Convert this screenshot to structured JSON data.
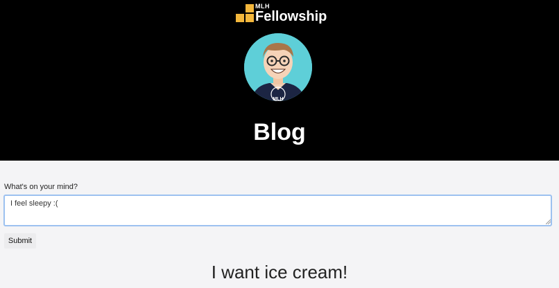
{
  "header": {
    "logo": {
      "small_text": "MLH",
      "big_text": "Fellowship",
      "color": "#f3b73c"
    },
    "avatar": {
      "icon": "avatar-illustration",
      "background": "#5ecfd8"
    },
    "title": "Blog",
    "background": "#000000"
  },
  "form": {
    "label": "What's on your mind?",
    "input_value": "I feel sleepy :(",
    "submit_label": "Submit"
  },
  "posts": [
    {
      "title": "I want ice cream!"
    }
  ]
}
